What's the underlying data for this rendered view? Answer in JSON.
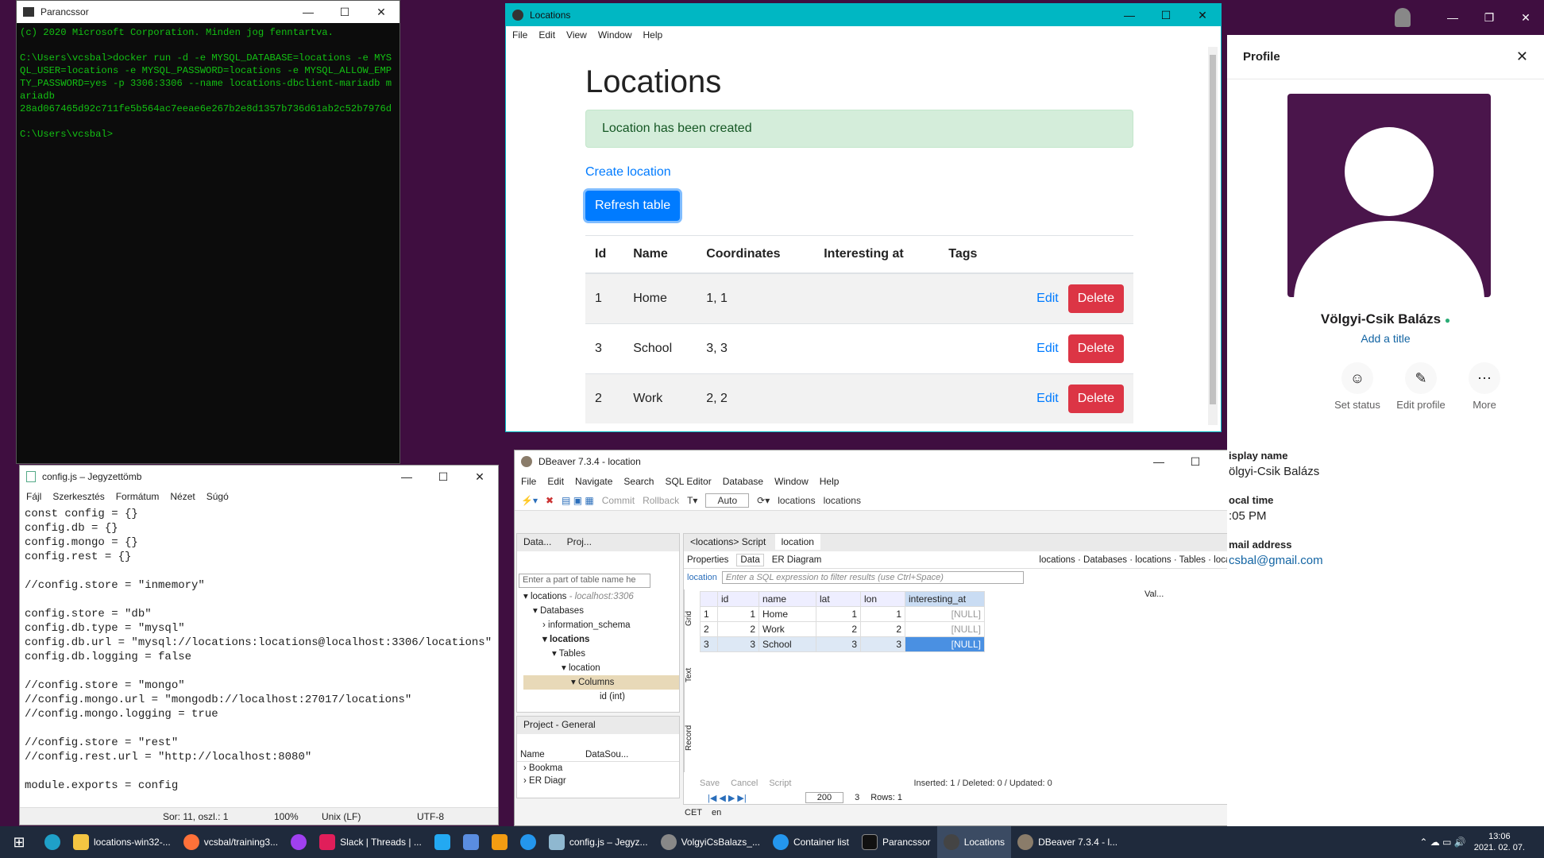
{
  "cmd": {
    "title": "Parancssor",
    "lines": "(c) 2020 Microsoft Corporation. Minden jog fenntartva.\n\nC:\\Users\\vcsbal>docker run -d -e MYSQL_DATABASE=locations -e MYSQL_USER=locations -e MYSQL_PASSWORD=locations -e MYSQL_ALLOW_EMPTY_PASSWORD=yes -p 3306:3306 --name locations-dbclient-mariadb mariadb\n28ad067465d92c711fe5b564ac7eeae6e267b2e8d1357b736d61ab2c52b7976d\n\nC:\\Users\\vcsbal>"
  },
  "notepad": {
    "title": "config.js – Jegyzettömb",
    "menu": [
      "Fájl",
      "Szerkesztés",
      "Formátum",
      "Nézet",
      "Súgó"
    ],
    "content": "const config = {}\nconfig.db = {}\nconfig.mongo = {}\nconfig.rest = {}\n\n//config.store = \"inmemory\"\n\nconfig.store = \"db\"\nconfig.db.type = \"mysql\"\nconfig.db.url = \"mysql://locations:locations@localhost:3306/locations\"\nconfig.db.logging = false\n\n//config.store = \"mongo\"\n//config.mongo.url = \"mongodb://localhost:27017/locations\"\n//config.mongo.logging = true\n\n//config.store = \"rest\"\n//config.rest.url = \"http://localhost:8080\"\n\nmodule.exports = config",
    "status": {
      "pos": "Sor: 11, oszl.: 1",
      "zoom": "100%",
      "eol": "Unix (LF)",
      "enc": "UTF-8"
    }
  },
  "loc": {
    "title": "Locations",
    "menu": [
      "File",
      "Edit",
      "View",
      "Window",
      "Help"
    ],
    "heading": "Locations",
    "alert": "Location has been created",
    "create": "Create location",
    "refresh": "Refresh table",
    "headers": [
      "Id",
      "Name",
      "Coordinates",
      "Interesting at",
      "Tags"
    ],
    "rows": [
      {
        "id": "1",
        "name": "Home",
        "coord": "1, 1"
      },
      {
        "id": "3",
        "name": "School",
        "coord": "3, 3"
      },
      {
        "id": "2",
        "name": "Work",
        "coord": "2, 2"
      }
    ],
    "edit": "Edit",
    "delete": "Delete"
  },
  "dbeaver": {
    "title": "DBeaver 7.3.4 - location",
    "menu": [
      "File",
      "Edit",
      "Navigate",
      "Search",
      "SQL Editor",
      "Database",
      "Window",
      "Help"
    ],
    "toolbar": {
      "commit": "Commit",
      "rollback": "Rollback",
      "auto": "Auto",
      "locations1": "locations",
      "locations2": "locations"
    },
    "nav": {
      "tab1": "Data...",
      "tab2": "Proj...",
      "filter": "Enter a part of table name he",
      "conn": "locations",
      "host": "- localhost:3306",
      "databases": "Databases",
      "info": "information_schema",
      "db": "locations",
      "tables": "Tables",
      "table": "location",
      "columns": "Columns",
      "col": "id (int)"
    },
    "project": {
      "tab": "Project - General",
      "name": "Name",
      "ds": "DataSou...",
      "b1": "Bookma",
      "b2": "ER Diagr"
    },
    "editor": {
      "tab1": "<locations> Script",
      "tab2": "location",
      "props": "Properties",
      "data": "Data",
      "er": "ER Diagram",
      "bc1": "locations",
      "bc2": "Databases",
      "bc3": "locations",
      "bc4": "Tables",
      "bc5": "location",
      "filterLabel": "location",
      "filterPh": "Enter a SQL expression to filter results (use Ctrl+Space)"
    },
    "cols": [
      "id",
      "name",
      "lat",
      "lon",
      "interesting_at"
    ],
    "rows": [
      [
        "1",
        "1",
        "Home",
        "1",
        "1",
        "[NULL]"
      ],
      [
        "2",
        "2",
        "Work",
        "2",
        "2",
        "[NULL]"
      ],
      [
        "3",
        "3",
        "School",
        "3",
        "3",
        "[NULL]"
      ]
    ],
    "side": [
      "Grid",
      "Text",
      "Record"
    ],
    "footer": {
      "save": "Save",
      "cancel": "Cancel",
      "script": "Script",
      "stats": "Inserted: 1 / Deleted: 0 / Updated: 0",
      "fetch": "200",
      "count": "3",
      "rows": "Rows: 1",
      "tz": "CET",
      "lang": "en",
      "val": "Val..."
    }
  },
  "slack": {
    "title": "Profile",
    "name": "Völgyi-Csik Balázs",
    "addTitle": "Add a title",
    "actions": [
      "Set status",
      "Edit profile",
      "More"
    ],
    "fields": [
      {
        "label": "isplay name",
        "value": "ölgyi-Csik Balázs"
      },
      {
        "label": "ocal time",
        "value": ":05 PM"
      },
      {
        "label": "mail address",
        "value": "csbal@gmail.com"
      }
    ]
  },
  "taskbar": {
    "items": [
      "locations-win32-...",
      "vcsbal/training3...",
      "Slack | Threads | ...",
      "config.js – Jegyz...",
      "VolgyiCsBalazs_...",
      "Container list",
      "Parancssor",
      "Locations",
      "DBeaver 7.3.4 - l..."
    ],
    "time": "13:06",
    "date": "2021. 02. 07."
  }
}
